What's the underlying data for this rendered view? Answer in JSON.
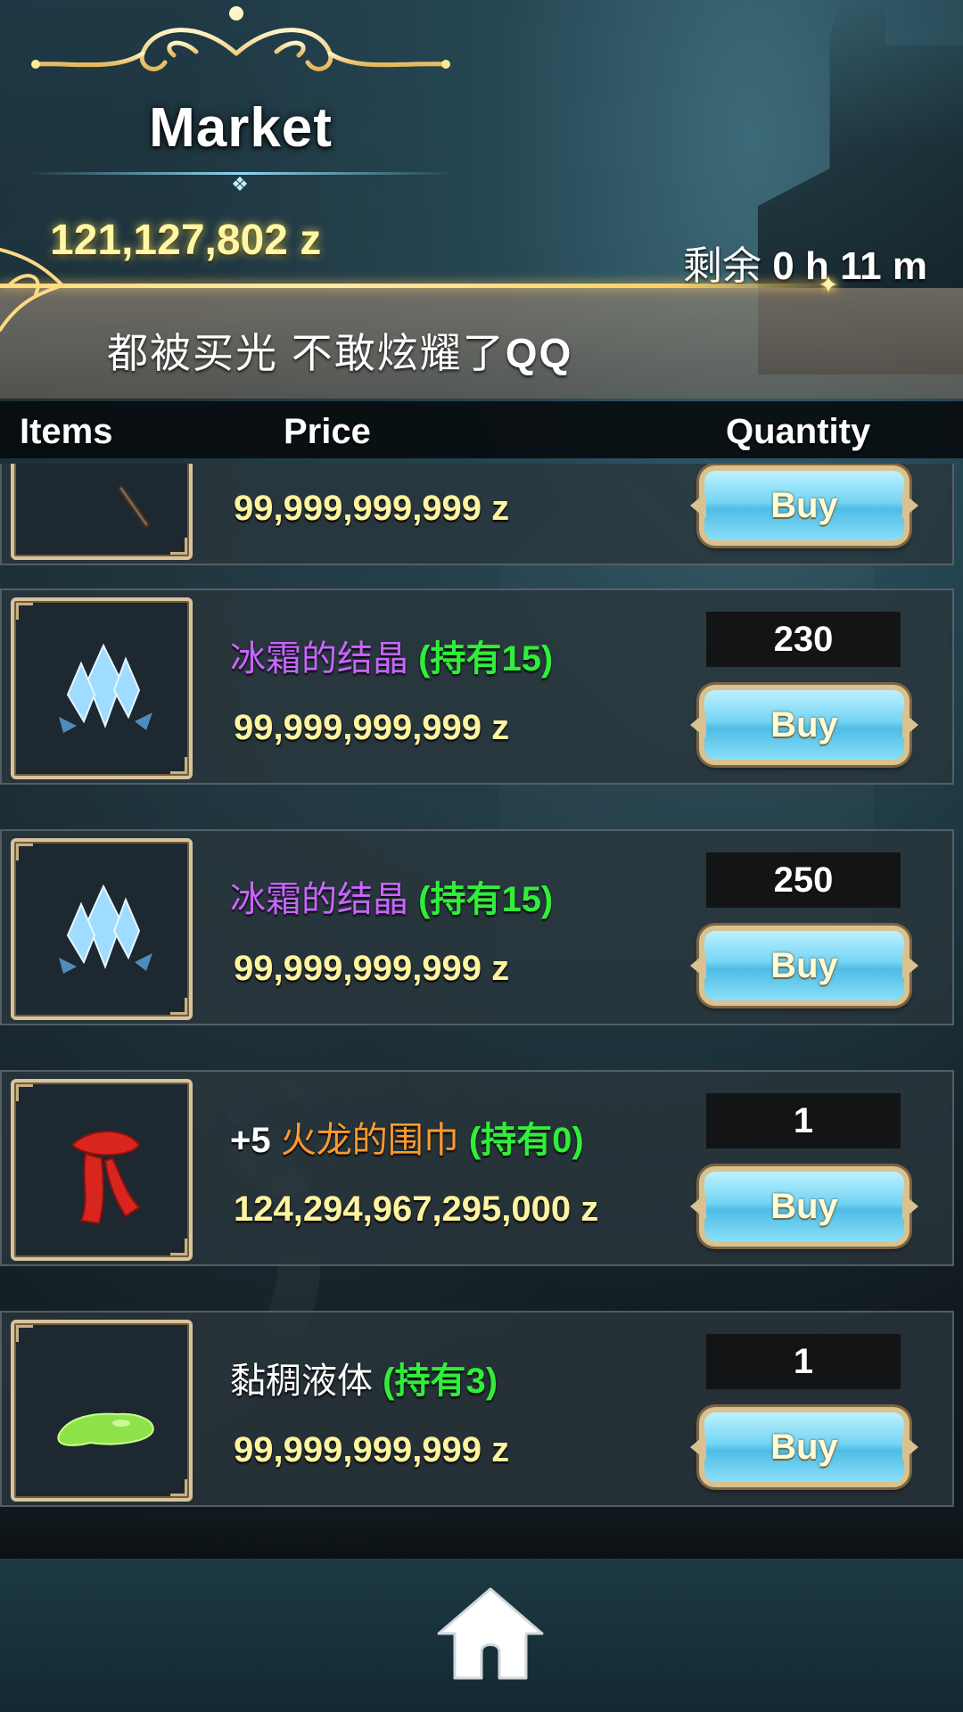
{
  "header": {
    "title": "Market",
    "currency": "121,127,802 z",
    "timer": {
      "prefix": "剩余",
      "hours": "0",
      "hours_unit": "h",
      "minutes": "11",
      "minutes_unit": "m"
    },
    "notice_text": "都被买光 不敢炫耀了",
    "notice_emote": "QQ"
  },
  "columns": {
    "items": "Items",
    "price": "Price",
    "quantity": "Quantity"
  },
  "items": [
    {
      "icon": "staff-icon",
      "name_prefix": "",
      "name": "",
      "held": "",
      "price": "99,999,999,999 z",
      "quantity": "",
      "buy_label": "Buy"
    },
    {
      "icon": "frost-crystal-icon",
      "name_prefix": "",
      "name": "冰霜的结晶",
      "name_color": "#c865ff",
      "held": "(持有15)",
      "price": "99,999,999,999 z",
      "quantity": "230",
      "buy_label": "Buy"
    },
    {
      "icon": "frost-crystal-icon",
      "name_prefix": "",
      "name": "冰霜的结晶",
      "name_color": "#c865ff",
      "held": "(持有15)",
      "price": "99,999,999,999 z",
      "quantity": "250",
      "buy_label": "Buy"
    },
    {
      "icon": "red-scarf-icon",
      "name_prefix": "+5",
      "name": "火龙的围巾",
      "name_color": "#ff9a2e",
      "held": "(持有0)",
      "price": "124,294,967,295,000 z",
      "quantity": "1",
      "buy_label": "Buy"
    },
    {
      "icon": "green-slime-icon",
      "name_prefix": "",
      "name": "黏稠液体",
      "name_color": "#ffffff",
      "held": "(持有3)",
      "price": "99,999,999,999 z",
      "quantity": "1",
      "buy_label": "Buy"
    }
  ],
  "footer": {
    "home_icon": "home-icon"
  },
  "colors": {
    "gold_text": "#fff4a0",
    "held_green": "#30ee3a",
    "rare_purple": "#c865ff",
    "legendary_orange": "#ff9a2e",
    "buy_button": "#75d5f4"
  }
}
